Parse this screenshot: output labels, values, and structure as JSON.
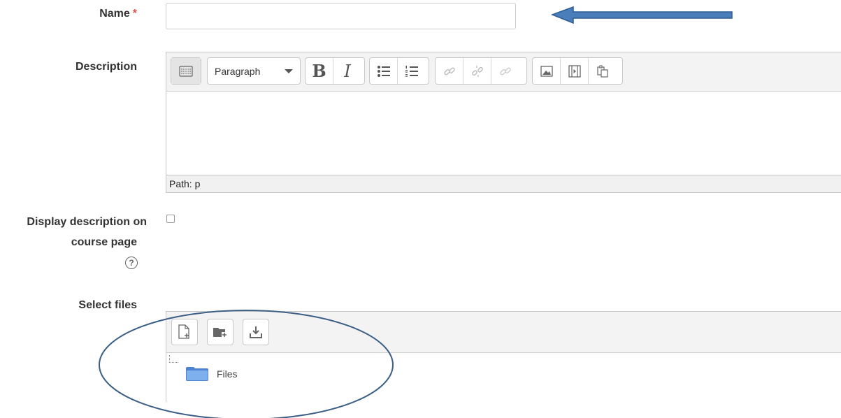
{
  "form": {
    "name_label": "Name",
    "required_mark": "*",
    "name_value": "",
    "description_label": "Description",
    "display_desc_label_line1": "Display description on",
    "display_desc_label_line2": "course page",
    "display_desc_checked": false,
    "select_files_label": "Select files"
  },
  "editor": {
    "block_format": "Paragraph",
    "bold_glyph": "B",
    "italic_glyph": "I",
    "content": "",
    "path_text": "Path: p",
    "buttons": [
      "keyboard-toggle",
      "paragraph-format",
      "bold",
      "italic",
      "unordered-list",
      "ordered-list",
      "link",
      "unlink",
      "anchor",
      "image",
      "media",
      "paste"
    ]
  },
  "help": {
    "glyph": "?"
  },
  "filemanager": {
    "buttons": [
      "add-file",
      "create-folder",
      "download"
    ],
    "root_folder": "Files"
  },
  "annotations": {
    "arrow_color": "#4a7ebb",
    "ellipse_color": "#3c5f86"
  }
}
